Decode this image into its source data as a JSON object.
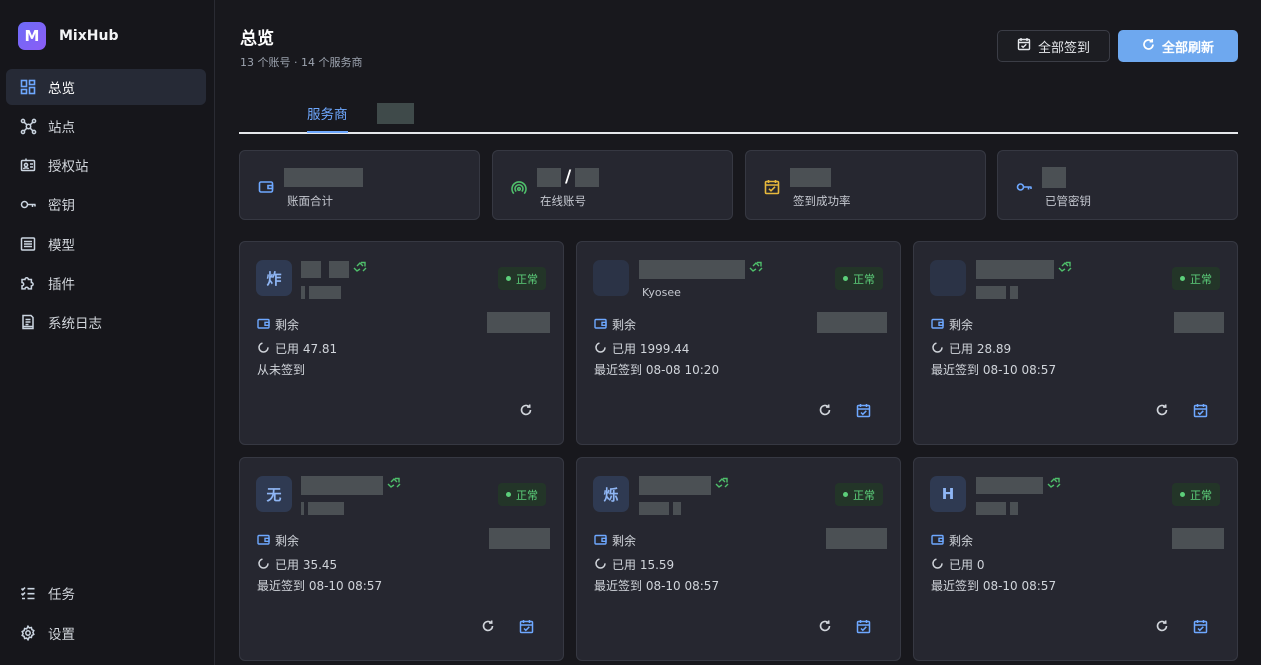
{
  "app": {
    "name": "MixHub",
    "logo_letter": "M"
  },
  "sidebar": {
    "items": [
      {
        "label": "总览",
        "icon": "dashboard-icon",
        "active": true
      },
      {
        "label": "站点",
        "icon": "network-icon"
      },
      {
        "label": "授权站",
        "icon": "id-card-icon"
      },
      {
        "label": "密钥",
        "icon": "key-icon"
      },
      {
        "label": "模型",
        "icon": "list-icon"
      },
      {
        "label": "插件",
        "icon": "puzzle-icon"
      },
      {
        "label": "系统日志",
        "icon": "log-icon"
      }
    ],
    "bottom_items": [
      {
        "label": "任务",
        "icon": "tasks-icon"
      },
      {
        "label": "设置",
        "icon": "gear-icon"
      }
    ]
  },
  "header": {
    "title": "总览",
    "subtitle": "13 个账号 · 14 个服务商",
    "checkin_all_label": "全部签到",
    "refresh_all_label": "全部刷新"
  },
  "tabs": [
    {
      "label": "服务商",
      "active": true
    },
    {
      "label": "",
      "redacted": true
    }
  ],
  "stats": [
    {
      "label": "账面合计",
      "icon": "wallet-icon",
      "icon_color": "#6ea8ff"
    },
    {
      "label": "在线账号",
      "icon": "signal-icon",
      "icon_color": "#4fbf6b",
      "separator": "/"
    },
    {
      "label": "签到成功率",
      "icon": "calendar-check-icon",
      "icon_color": "#e7b93c"
    },
    {
      "label": "已管密钥",
      "icon": "key-icon",
      "icon_color": "#6ea8ff"
    }
  ],
  "cards": [
    {
      "avatar": "炸",
      "subtitle": "",
      "status": "正常",
      "remain_label": "剩余",
      "used": "已用 47.81",
      "last_checkin": "从未签到",
      "has_checkin": false
    },
    {
      "avatar": "",
      "subtitle": "Kyosee",
      "status": "正常",
      "remain_label": "剩余",
      "used": "已用 1999.44",
      "last_checkin": "最近签到 08-08 10:20",
      "has_checkin": true
    },
    {
      "avatar": "",
      "subtitle": "",
      "status": "正常",
      "remain_label": "剩余",
      "used": "已用 28.89",
      "last_checkin": "最近签到 08-10 08:57",
      "has_checkin": true
    },
    {
      "avatar": "无",
      "subtitle": "",
      "status": "正常",
      "remain_label": "剩余",
      "used": "已用 35.45",
      "last_checkin": "最近签到 08-10 08:57",
      "has_checkin": true
    },
    {
      "avatar": "烁",
      "subtitle": "",
      "status": "正常",
      "remain_label": "剩余",
      "used": "已用 15.59",
      "last_checkin": "最近签到 08-10 08:57",
      "has_checkin": true
    },
    {
      "avatar": "H",
      "subtitle": "",
      "status": "正常",
      "remain_label": "剩余",
      "used": "已用 0",
      "last_checkin": "最近签到 08-10 08:57",
      "has_checkin": true
    }
  ]
}
